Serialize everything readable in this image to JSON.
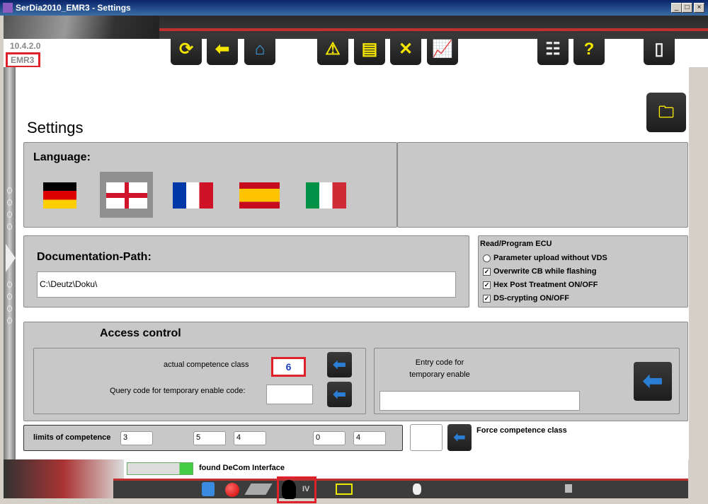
{
  "window": {
    "title": "SerDia2010_EMR3 - Settings",
    "min": "_",
    "max": "□",
    "close": "×"
  },
  "header": {
    "version": "10.4.2.0",
    "ecu": "EMR3"
  },
  "toolbar": [
    "refresh-icon",
    "back-arrow-icon",
    "home-icon",
    "warning-icon",
    "document-icon",
    "tools-icon",
    "chart-icon",
    "settings-sliders-icon",
    "help-icon",
    "exit-door-icon"
  ],
  "page": {
    "title": "Settings"
  },
  "language": {
    "label": "Language:",
    "flags": [
      "German",
      "English",
      "French",
      "Spanish",
      "Italian"
    ],
    "selected": "English"
  },
  "documentation": {
    "label": "Documentation-Path:",
    "value": "C:\\Deutz\\Doku\\"
  },
  "read_program": {
    "title": "Read/Program ECU",
    "options": [
      {
        "label": "Parameter upload without VDS",
        "checked": false
      },
      {
        "label": "Overwrite CB while flashing",
        "checked": true
      },
      {
        "label": "Hex Post Treatment ON/OFF",
        "checked": true
      },
      {
        "label": "DS-crypting ON/OFF",
        "checked": true
      }
    ]
  },
  "access": {
    "title": "Access control",
    "actual_label": "actual competence class",
    "actual_value": "6",
    "query_label": "Query code for temporary enable code:",
    "query_value": "",
    "entry_label": "Entry code for\ntemporary enable",
    "entry_value": ""
  },
  "limits": {
    "label": "limits of competence",
    "values": [
      "3",
      "5",
      "4",
      "0",
      "4"
    ],
    "force_value": "",
    "force_label": "Force competence class"
  },
  "status": {
    "text": "found DeCom Interface",
    "mode": "IV"
  },
  "colors": {
    "accent": "#c0302f",
    "highlight": "#e0202a",
    "value": "#1a3fc0"
  }
}
